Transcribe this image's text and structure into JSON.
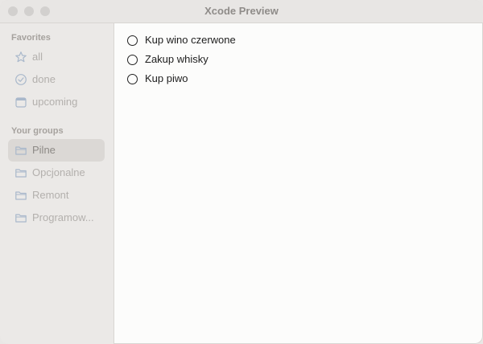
{
  "window": {
    "title": "Xcode Preview"
  },
  "sidebar": {
    "favorites_title": "Favorites",
    "favorites": [
      {
        "label": "all",
        "icon": "star-icon"
      },
      {
        "label": "done",
        "icon": "checkmark-circle-icon"
      },
      {
        "label": "upcoming",
        "icon": "calendar-icon"
      }
    ],
    "groups_title": "Your groups",
    "groups": [
      {
        "label": "Pilne",
        "icon": "folder-icon",
        "selected": true
      },
      {
        "label": "Opcjonalne",
        "icon": "folder-icon"
      },
      {
        "label": "Remont",
        "icon": "folder-icon"
      },
      {
        "label": "Programow...",
        "icon": "folder-icon"
      }
    ]
  },
  "main": {
    "tasks": [
      {
        "label": "Kup wino czerwone",
        "done": false
      },
      {
        "label": "Zakup whisky",
        "done": false
      },
      {
        "label": "Kup piwo",
        "done": false
      }
    ]
  },
  "colors": {
    "accent_icon": "#a9b8cb",
    "selected_bg": "#dbd8d5",
    "sidebar_bg": "#ebe9e7",
    "content_bg": "#fcfcfb"
  }
}
